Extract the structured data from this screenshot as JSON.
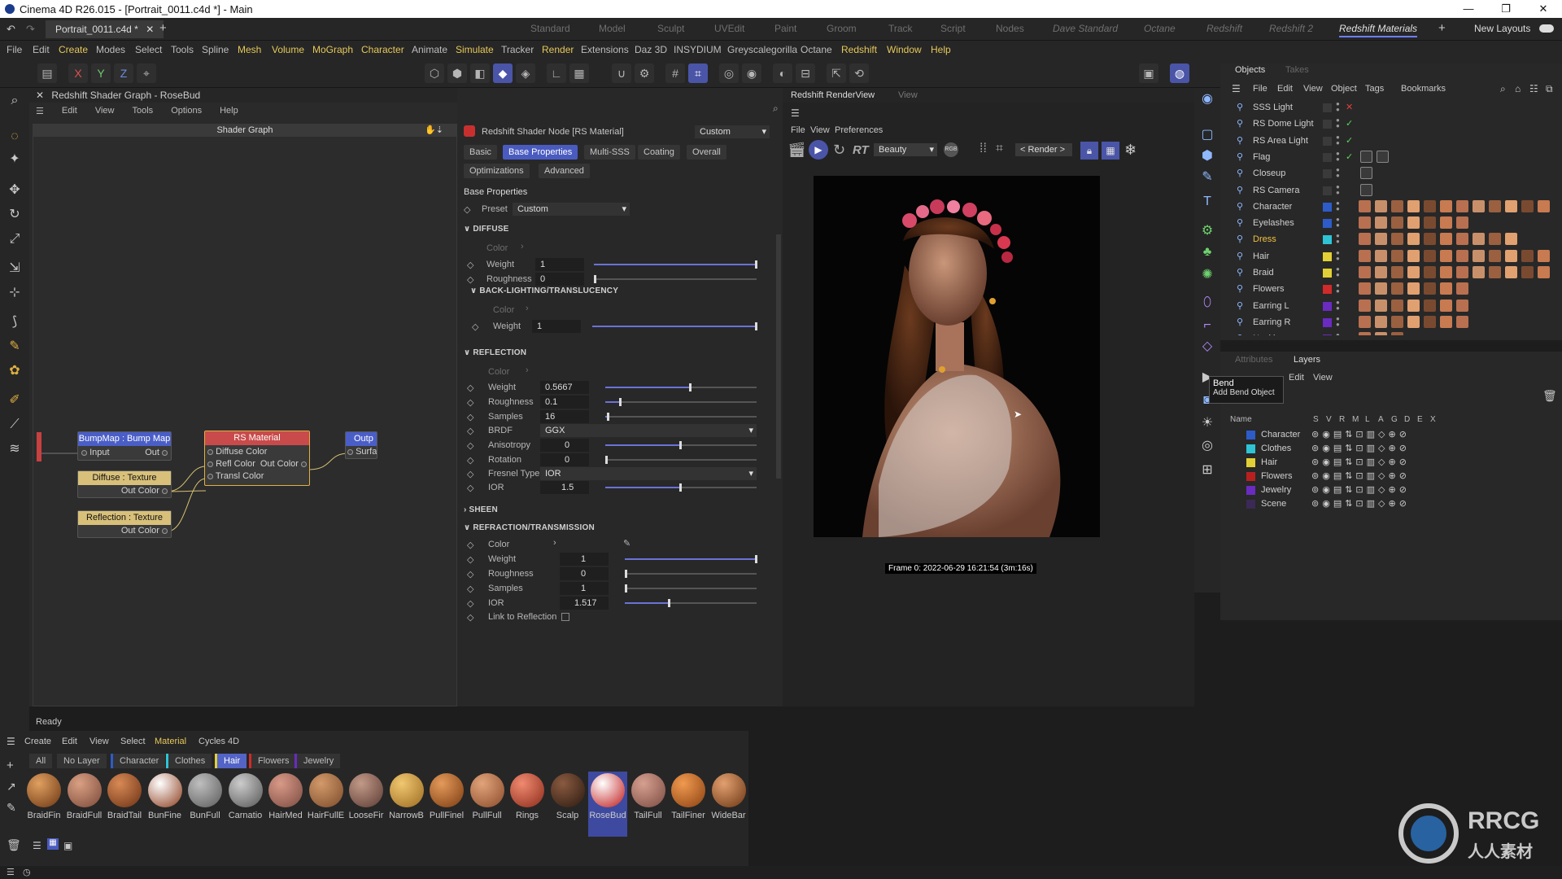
{
  "window": {
    "title": "Cinema 4D R26.015 - [Portrait_0011.c4d *] - Main",
    "min": "—",
    "max": "❐",
    "close": "✕"
  },
  "tabs": {
    "doc": "Portrait_0011.c4d *",
    "layouts": [
      "Standard",
      "Model",
      "Sculpt",
      "UVEdit",
      "Paint",
      "Groom",
      "Track",
      "Script",
      "Nodes",
      "Dave Standard",
      "Octane",
      "Redshift",
      "Redshift 2",
      "Redshift Materials"
    ],
    "new_layouts": "New Layouts"
  },
  "menu": [
    "File",
    "Edit",
    "Create",
    "Modes",
    "Select",
    "Tools",
    "Spline",
    "Mesh",
    "Volume",
    "MoGraph",
    "Character",
    "Animate",
    "Simulate",
    "Tracker",
    "Render",
    "Extensions",
    "Daz 3D",
    "INSYDIUM",
    "Greyscalegorilla",
    "Octane",
    "Redshift",
    "Window",
    "Help"
  ],
  "shader_graph": {
    "title": "Redshift Shader Graph - RoseBud",
    "menu": [
      "Edit",
      "View",
      "Tools",
      "Options",
      "Help"
    ],
    "canvas_title": "Shader Graph",
    "nodes": {
      "bump": {
        "title": "BumpMap : Bump Map",
        "in": "Input",
        "out": "Out"
      },
      "diffuse": {
        "title": "Diffuse : Texture",
        "out": "Out Color"
      },
      "reflection": {
        "title": "Reflection : Texture",
        "out": "Out Color"
      },
      "rs": {
        "title": "RS Material",
        "inputs": [
          "Diffuse Color",
          "Refl Color",
          "Transl Color"
        ],
        "out": "Out Color"
      },
      "output": {
        "title": "Outp",
        "in": "Surfa"
      }
    }
  },
  "attributes": {
    "header": "Redshift Shader Node [RS Material]",
    "mode": "Custom",
    "tabs": [
      "Basic",
      "Base Properties",
      "Multi-SSS",
      "Coating",
      "Overall",
      "Optimizations",
      "Advanced"
    ],
    "section_title": "Base Properties",
    "preset_label": "Preset",
    "preset_value": "Custom",
    "diffuse": {
      "title": "DIFFUSE",
      "color": "Color",
      "weight": "Weight",
      "weight_val": "1",
      "weight_frac": 1,
      "rough": "Roughness",
      "rough_val": "0",
      "rough_frac": 0
    },
    "backlight": {
      "title": "BACK-LIGHTING/TRANSLUCENCY",
      "color": "Color",
      "weight": "Weight",
      "weight_val": "1",
      "weight_frac": 1
    },
    "reflection": {
      "title": "REFLECTION",
      "color": "Color",
      "weight": "Weight",
      "weight_val": "0.5667",
      "weight_frac": 0.5667,
      "rough": "Roughness",
      "rough_val": "0.1",
      "rough_frac": 0.1,
      "samples": "Samples",
      "samples_val": "16",
      "samples_frac": 0.02,
      "brdf": "BRDF",
      "brdf_val": "GGX",
      "aniso": "Anisotropy",
      "aniso_val": "0",
      "aniso_frac": 0.5,
      "rot": "Rotation",
      "rot_val": "0",
      "rot_frac": 0,
      "fresnel": "Fresnel Type",
      "fresnel_val": "IOR",
      "ior": "IOR",
      "ior_val": "1.5",
      "ior_frac": 0.5
    },
    "sheen": {
      "title": "SHEEN"
    },
    "refraction": {
      "title": "REFRACTION/TRANSMISSION",
      "color": "Color",
      "weight": "Weight",
      "weight_val": "1",
      "weight_frac": 1,
      "rough": "Roughness",
      "rough_val": "0",
      "rough_frac": 0,
      "samples": "Samples",
      "samples_val": "1",
      "samples_frac": 0,
      "ior": "IOR",
      "ior_val": "1.517",
      "ior_frac": 0.34,
      "link": "Link to Reflection"
    }
  },
  "renderview": {
    "tab": "Redshift RenderView",
    "tab2": "View",
    "menu": [
      "File",
      "View",
      "Preferences"
    ],
    "aov": "Beauty",
    "render": "< Render >",
    "rt": "RT",
    "frame_info": "Frame  0:  2022-06-29  16:21:54  (3m:16s)"
  },
  "objects": {
    "tabs": [
      "Objects",
      "Takes"
    ],
    "menu": [
      "File",
      "Edit",
      "View",
      "Object",
      "Tags",
      "Bookmarks"
    ],
    "rows": [
      {
        "name": "SSS Light",
        "color": "#3a3a3a"
      },
      {
        "name": "RS Dome Light",
        "color": "#3a3a3a"
      },
      {
        "name": "RS Area Light",
        "color": "#3a3a3a"
      },
      {
        "name": "Flag",
        "color": "#3a3a3a"
      },
      {
        "name": "Closeup",
        "color": "#3a3a3a"
      },
      {
        "name": "RS Camera",
        "color": "#3a3a3a"
      },
      {
        "name": "Character",
        "color": "#2d5cc8"
      },
      {
        "name": "Eyelashes",
        "color": "#2d5cc8"
      },
      {
        "name": "Dress",
        "color": "#2ec4d6"
      },
      {
        "name": "Hair",
        "color": "#e2cf35"
      },
      {
        "name": "Braid",
        "color": "#e2cf35"
      },
      {
        "name": "Flowers",
        "color": "#d02a2a"
      },
      {
        "name": "Earring L",
        "color": "#6a2bc0"
      },
      {
        "name": "Earring R",
        "color": "#6a2bc0"
      },
      {
        "name": "Necklace",
        "color": "#6a2bc0"
      }
    ]
  },
  "tooltip": {
    "title": "Bend",
    "sub": "Add Bend Object"
  },
  "layers": {
    "tabs": [
      "Attributes",
      "Layers"
    ],
    "menu": [
      "Edit",
      "View"
    ],
    "cols": [
      "Name",
      "S",
      "V",
      "R",
      "M",
      "L",
      "A",
      "G",
      "D",
      "E",
      "X"
    ],
    "rows": [
      {
        "name": "Character",
        "color": "#2d5cc8"
      },
      {
        "name": "Clothes",
        "color": "#2ec4d6"
      },
      {
        "name": "Hair",
        "color": "#e2cf35"
      },
      {
        "name": "Flowers",
        "color": "#b82020"
      },
      {
        "name": "Jewelry",
        "color": "#6a2bc0"
      },
      {
        "name": "Scene",
        "color": "#3a2a55"
      }
    ]
  },
  "status": "Ready",
  "materials": {
    "menu": [
      "Create",
      "Edit",
      "View",
      "Select",
      "Material",
      "Cycles 4D"
    ],
    "filters": [
      "All",
      "No Layer",
      "Character",
      "Clothes",
      "Hair",
      "Flowers",
      "Jewelry"
    ],
    "active_filter": "Hair",
    "items": [
      {
        "name": "BraidFin",
        "c1": "#e0a060",
        "c2": "#6a3512"
      },
      {
        "name": "BraidFull",
        "c1": "#d9a083",
        "c2": "#7a4838"
      },
      {
        "name": "BraidTail",
        "c1": "#d88a55",
        "c2": "#6b3014"
      },
      {
        "name": "BunFine",
        "c1": "#ffffff",
        "c2": "#8a3a1a"
      },
      {
        "name": "BunFull",
        "c1": "#bfbfbf",
        "c2": "#5a5a5a"
      },
      {
        "name": "Carnatio",
        "c1": "#cccccc",
        "c2": "#555555"
      },
      {
        "name": "HairMed",
        "c1": "#d99a88",
        "c2": "#7a4a40"
      },
      {
        "name": "HairFullE",
        "c1": "#d39a6a",
        "c2": "#7a4a2a"
      },
      {
        "name": "LooseFir",
        "c1": "#c29a88",
        "c2": "#5a3a32"
      },
      {
        "name": "NarrowB",
        "c1": "#f1c770",
        "c2": "#9a6a20"
      },
      {
        "name": "PullFinel",
        "c1": "#e49a5a",
        "c2": "#7a3a10"
      },
      {
        "name": "PullFull",
        "c1": "#e1a47a",
        "c2": "#8a4a2a"
      },
      {
        "name": "Rings",
        "c1": "#f08a70",
        "c2": "#8a2a1a"
      },
      {
        "name": "Scalp",
        "c1": "#8a5a40",
        "c2": "#2a1a10"
      },
      {
        "name": "RoseBud",
        "c1": "#ffffff",
        "c2": "#c01818"
      },
      {
        "name": "TailFull",
        "c1": "#d6a090",
        "c2": "#7a4a40"
      },
      {
        "name": "TailFiner",
        "c1": "#f09a50",
        "c2": "#8a4010"
      },
      {
        "name": "WideBar",
        "c1": "#e2a070",
        "c2": "#6a3512"
      }
    ],
    "selected": "RoseBud"
  },
  "watermark": {
    "text1": "RRCG",
    "text2": "人人素材"
  }
}
